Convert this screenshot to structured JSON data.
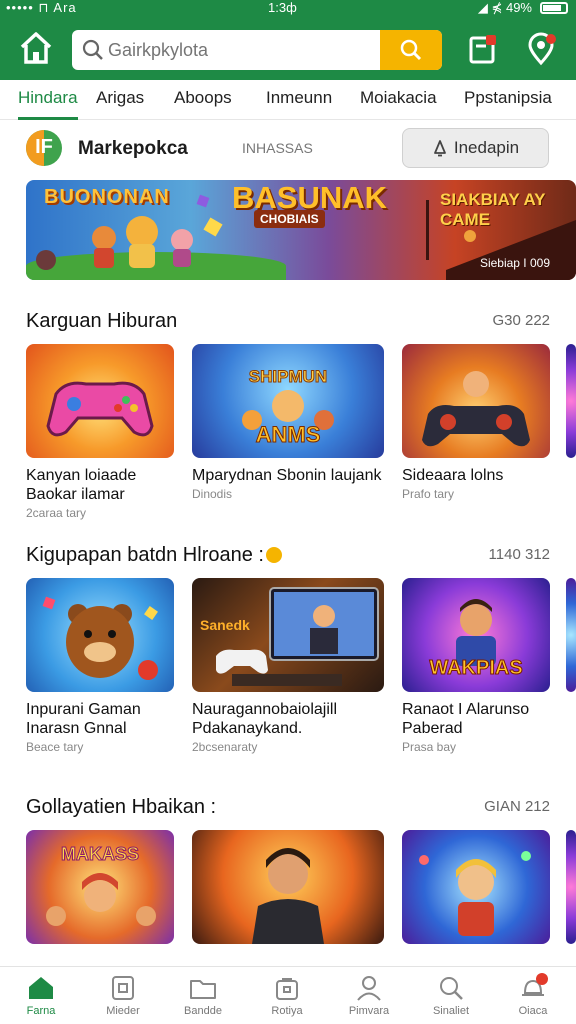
{
  "status_bar": {
    "left": "••••• ⊓ Ara",
    "time": "1:3ф",
    "right": "◢ ⋠ 49%"
  },
  "header": {
    "search_placeholder": "Gairkpkylota",
    "icons": [
      "home-icon",
      "search-icon",
      "bookmark-icon",
      "location-icon"
    ],
    "brand_color": "#1e8a45",
    "accent_color": "#f5b400"
  },
  "tabs": [
    "Hindara",
    "Arigas",
    "Aboops",
    "Inmeunn",
    "Moiakacia",
    "Ppstanipsia"
  ],
  "brand": {
    "name": "Markepokca",
    "subtitle": "INHASSAS",
    "button_label": "Inedapin"
  },
  "banner": {
    "title_left": "BUONONAN",
    "title_main": "BASUNAK",
    "title_tag": "CHOBIAIS",
    "title_right": "SIAKBIAY AY CAME",
    "footnote": "Siebiap I 009"
  },
  "sections": [
    {
      "title": "Karguan Hiburan",
      "more": "G30 222",
      "cards": [
        {
          "title": "Kanyan loiaade Baokar ilamar",
          "meta": "2caraa tary"
        },
        {
          "title": "Mparydnan Sbonin laujank",
          "meta": "Dinodis"
        },
        {
          "title": "Sideaara lolns",
          "meta": "Prafo tary"
        }
      ]
    },
    {
      "title": "Kigupapan batdn  Hlroane :",
      "more": "1140 312",
      "cards": [
        {
          "title": "Inpurani Gaman Inarasn Gnnal",
          "meta": "Beace tary"
        },
        {
          "title": "Nauragannobaiolajill Pdakanaykand.",
          "meta": "2bcsenaraty"
        },
        {
          "title": "Ranaot I Alarunso Paberad",
          "meta": "Prasa bay"
        }
      ]
    },
    {
      "title": "Gollayatien Hbaikan :",
      "more": "GІAN 212",
      "cards": [
        {
          "title": "",
          "meta": ""
        },
        {
          "title": "",
          "meta": ""
        },
        {
          "title": "",
          "meta": ""
        }
      ]
    }
  ],
  "bottom_nav": [
    {
      "label": "Farna",
      "icon": "home-icon",
      "active": true
    },
    {
      "label": "Mieder",
      "icon": "media-icon"
    },
    {
      "label": "Bandde",
      "icon": "folder-icon"
    },
    {
      "label": "Rotiya",
      "icon": "bag-icon"
    },
    {
      "label": "Pimvara",
      "icon": "profile-icon"
    },
    {
      "label": "Sinaliet",
      "icon": "search-icon"
    },
    {
      "label": "Oiaca",
      "icon": "notification-icon"
    }
  ]
}
